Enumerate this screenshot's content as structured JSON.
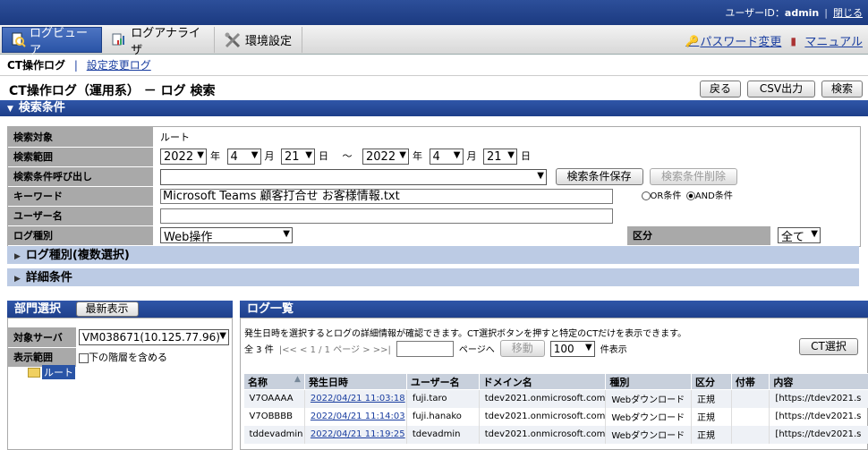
{
  "topbar": {
    "user_label": "ユーザーID：",
    "user_id": "admin",
    "sep": "|",
    "logout": "閉じる"
  },
  "menu": {
    "items": [
      {
        "label": "ログビューア",
        "icon": "log-viewer-icon"
      },
      {
        "label": "ログアナライザ",
        "icon": "log-analyzer-icon"
      },
      {
        "label": "環境設定",
        "icon": "settings-tools-icon"
      }
    ],
    "password": "パスワード変更",
    "manual": "マニュアル"
  },
  "subnav": {
    "current": "CT操作ログ",
    "sep": "|",
    "link": "設定変更ログ"
  },
  "page": {
    "title": "CT操作ログ（運用系） － ログ 検索",
    "buttons": {
      "back": "戻る",
      "csv": "CSV出力",
      "search": "検索"
    }
  },
  "search": {
    "section_title": "検索条件",
    "target_label": "検索対象",
    "target_value": "ルート",
    "range_label": "検索範囲",
    "from": {
      "year": "2022",
      "month": "4",
      "day": "21"
    },
    "to": {
      "year": "2022",
      "month": "4",
      "day": "21"
    },
    "unit_year": "年",
    "unit_month": "月",
    "unit_day": "日",
    "tilde": "～",
    "recall_label": "検索条件呼び出し",
    "recall_value": "",
    "save_btn": "検索条件保存",
    "delete_btn": "検索条件削除",
    "keyword_label": "キーワード",
    "keyword_value": "Microsoft Teams 顧客打合せ お客様情報.txt",
    "or_label": "OR条件",
    "and_label": "AND条件",
    "user_label": "ユーザー名",
    "user_value": "",
    "logtype_label": "ログ種別",
    "logtype_value": "Web操作",
    "category_label": "区分",
    "category_value": "全て",
    "multi_label": "ログ種別(複数選択)",
    "detail_label": "詳細条件"
  },
  "dept": {
    "title": "部門選択",
    "refresh": "最新表示",
    "server_label": "対象サーバ",
    "server_value": "VM038671(10.125.77.96)",
    "scope_label": "表示範囲",
    "include_lower": "下の階層を含める",
    "tree_root": "ルート"
  },
  "loglist": {
    "title": "ログ一覧",
    "hint": "発生日時を選択するとログの詳細情報が確認できます。CT選択ボタンを押すと特定のCTだけを表示できます。",
    "total": "全 3 件",
    "pager": "|<< < 1 / 1 ページ > >>|",
    "goto_label": "ページへ",
    "goto_value": "",
    "move_btn": "移動",
    "per_page": "100",
    "per_page_label": "件表示",
    "ct_select": "CT選択",
    "columns": [
      "名称",
      "発生日時",
      "ユーザー名",
      "ドメイン名",
      "種別",
      "区分",
      "付帯",
      "内容"
    ],
    "rows": [
      {
        "name": "V7OAAAA",
        "time": "2022/04/21 11:03:18",
        "user": "fuji.taro",
        "domain": "tdev2021.onmicrosoft.com",
        "type": "Webダウンロード",
        "category": "正規",
        "extra": "",
        "content": "[https://tdev2021.s"
      },
      {
        "name": "V7OBBBB",
        "time": "2022/04/21 11:14:03",
        "user": "fuji.hanako",
        "domain": "tdev2021.onmicrosoft.com",
        "type": "Webダウンロード",
        "category": "正規",
        "extra": "",
        "content": "[https://tdev2021.s"
      },
      {
        "name": "tddevadmin",
        "time": "2022/04/21 11:19:25",
        "user": "tdevadmin",
        "domain": "tdev2021.onmicrosoft.com",
        "type": "Webダウンロード",
        "category": "正規",
        "extra": "",
        "content": "[https://tdev2021.s"
      }
    ]
  },
  "colors": {
    "nav_blue": "#1e3f8a",
    "label_gray": "#a9a9a9",
    "collapse_blue": "#bccbe4",
    "link": "#1a3ea0"
  }
}
